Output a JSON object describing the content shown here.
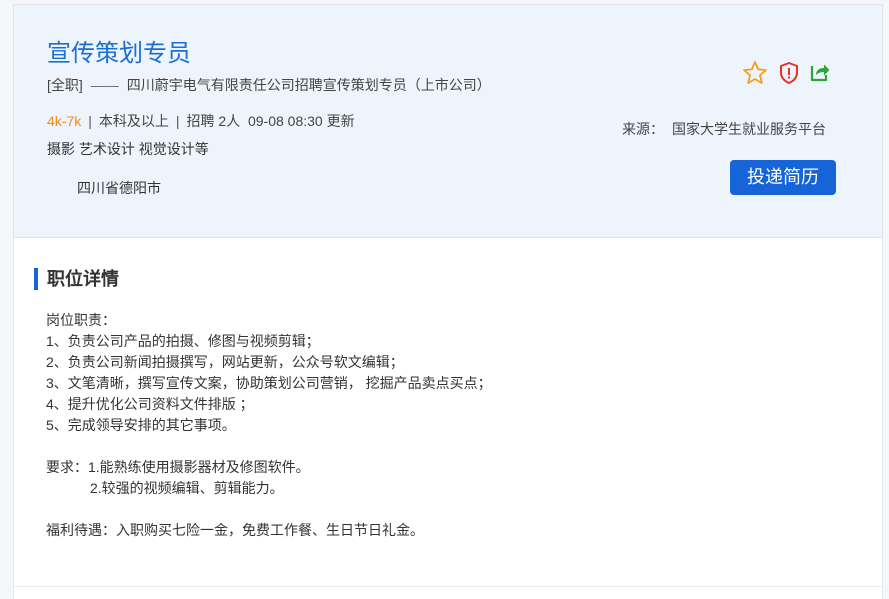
{
  "job": {
    "title": "宣传策划专员",
    "type": "[全职]",
    "dash": "——",
    "company_post": "四川蔚宇电气有限责任公司招聘宣传策划专员（上市公司）",
    "salary": "4k-7k",
    "sep": "|",
    "education": "本科及以上",
    "headcount": "招聘 2人",
    "updated": "09-08 08:30 更新",
    "skills": "摄影 艺术设计 视觉设计等",
    "location": "四川省德阳市"
  },
  "side": {
    "source_label": "来源：",
    "source_value": "国家大学生就业服务平台",
    "apply_label": "投递简历"
  },
  "icons": {
    "favorite": "star-icon",
    "report": "shield-icon",
    "share": "share-icon",
    "colors": {
      "star": "#f0a020",
      "shield": "#e0312b",
      "share": "#2aa63a"
    }
  },
  "detail": {
    "heading": "职位详情",
    "lines": [
      "岗位职责：",
      "1、负责公司产品的拍摄、修图与视频剪辑；",
      "2、负责公司新闻拍摄撰写，网站更新，公众号软文编辑；",
      "3、文笔清晰，撰写宣传文案，协助策划公司营销， 挖掘产品卖点买点；",
      "4、提升优化公司资料文件排版 ；",
      "5、完成领导安排的其它事项。"
    ],
    "req_1": "要求：1.能熟练使用摄影器材及修图软件。",
    "req_2": "2.较强的视频编辑、剪辑能力。",
    "benefits": "福利待遇：入职购买七险一金，免费工作餐、生日节日礼金。"
  }
}
